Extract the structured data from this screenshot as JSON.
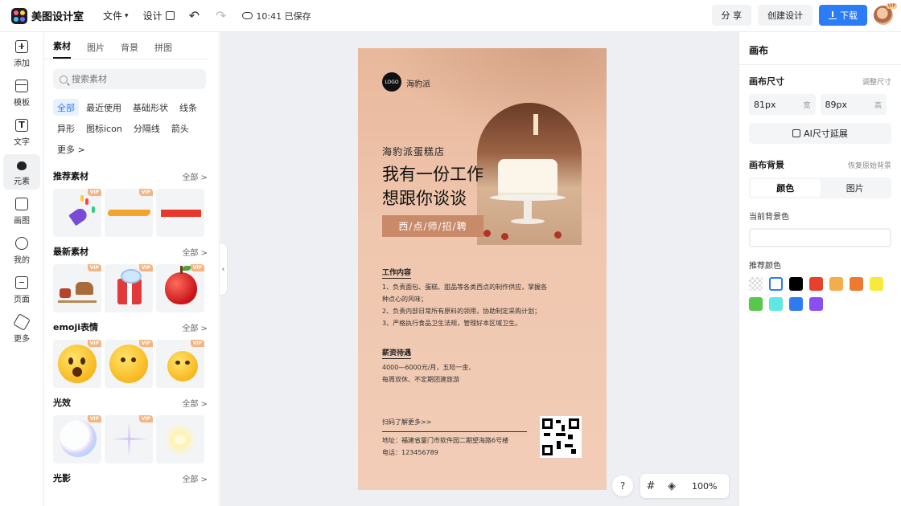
{
  "app": {
    "name": "美图设计室"
  },
  "topbar": {
    "file_menu": "文件",
    "design_menu": "设计",
    "save_status": "10:41 已保存",
    "share": "分 享",
    "create_design": "创建设计",
    "download": "下载",
    "vip_badge": "VIP"
  },
  "leftnav": {
    "items": [
      {
        "label": "添加",
        "icon": "add-icon"
      },
      {
        "label": "模板",
        "icon": "template-icon"
      },
      {
        "label": "文字",
        "icon": "text-icon"
      },
      {
        "label": "元素",
        "icon": "element-icon",
        "active": true
      },
      {
        "label": "画图",
        "icon": "draw-icon"
      },
      {
        "label": "我的",
        "icon": "user-icon"
      },
      {
        "label": "页面",
        "icon": "page-icon"
      },
      {
        "label": "更多",
        "icon": "more-icon"
      }
    ]
  },
  "materials": {
    "tabs": [
      "素材",
      "图片",
      "背景",
      "拼图"
    ],
    "active_tab": "素材",
    "search_placeholder": "搜索素材",
    "chips": [
      "全部",
      "最近使用",
      "基础形状",
      "线条",
      "异形",
      "图标icon",
      "分隔线",
      "箭头",
      "更多 >"
    ],
    "active_chip": "全部",
    "sections": [
      {
        "title": "推荐素材",
        "all": "全部 >",
        "vip": [
          true,
          true,
          false
        ]
      },
      {
        "title": "最新素材",
        "all": "全部 >",
        "vip": [
          true,
          true,
          true
        ]
      },
      {
        "title": "emoji表情",
        "all": "全部 >",
        "vip": [
          true,
          true,
          true
        ]
      },
      {
        "title": "光效",
        "all": "全部 >",
        "vip": [
          true,
          true,
          false
        ]
      },
      {
        "title": "光影",
        "all": "全部 >"
      }
    ],
    "vip_label": "VIP"
  },
  "poster": {
    "logo": "LOGO",
    "brand": "海豹派",
    "subtitle": "海豹派蛋糕店",
    "title_line1": "我有一份工作",
    "title_line2": "想跟你谈谈",
    "tag": "西/点/师/招/聘",
    "section1_title": "工作内容",
    "section1_lines": [
      "1、负责面包、蛋糕、甜品等各类西点的制作供应，掌握各",
      "种点心的风味；",
      "2、负责内部日常所有原料的领用，协助制定采购计划；",
      "3、严格执行食品卫生法规，管理好本区域卫生。"
    ],
    "section2_title": "薪资待遇",
    "section2_lines": [
      "4000—6000元/月，五险一金、",
      "每周双休、不定期团建旅游"
    ],
    "more_info": "扫码了解更多>>",
    "address": "地址：福建省厦门市软件园二期望海路6号楼",
    "phone": "电话：123456789"
  },
  "canvas_tools": {
    "help": "?",
    "zoom": "100%"
  },
  "right_panel": {
    "title": "画布",
    "size_label": "画布尺寸",
    "adjust_size": "调整尺寸",
    "width_value": "81px",
    "width_unit": "宽",
    "height_value": "89px",
    "height_unit": "高",
    "ai_extend": "AI尺寸延展",
    "bg_label": "画布背景",
    "restore_bg": "恢复原始背景",
    "bg_tabs": [
      "颜色",
      "图片"
    ],
    "current_bg": "当前背景色",
    "recommended": "推荐颜色",
    "swatches": [
      "transparent",
      "#ffffff",
      "#000000",
      "#e8402b",
      "#f4ad4d",
      "#ef7a2e",
      "#f7ea3c",
      "#57c84a",
      "#5ee8e4",
      "#2f7cf0",
      "#8a4ff0"
    ]
  }
}
